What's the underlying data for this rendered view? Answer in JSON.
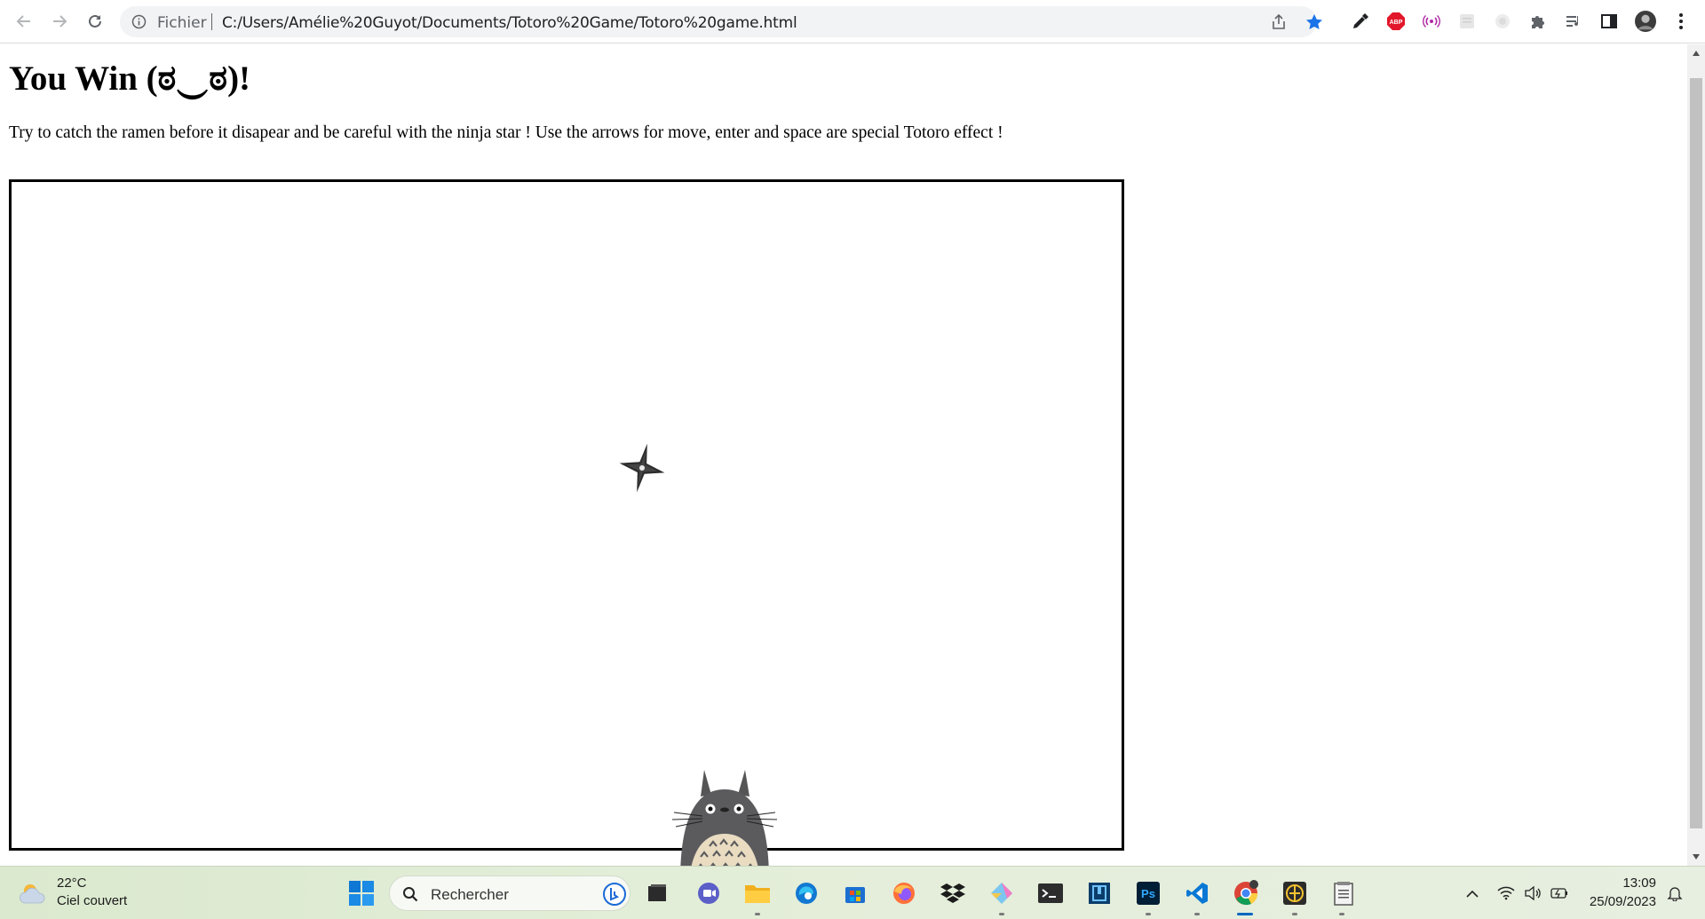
{
  "browser": {
    "scheme_label": "Fichier",
    "url": "C:/Users/Amélie%20Guyot/Documents/Totoro%20Game/Totoro%20game.html",
    "icons": [
      "back-icon",
      "forward-icon",
      "reload-icon",
      "info-icon",
      "share-icon",
      "bookmark-star-icon",
      "eyedropper-icon",
      "adblock-icon",
      "broadcast-icon",
      "extension-blank-icon",
      "extension-circle-icon",
      "puzzle-icon",
      "reading-list-icon",
      "side-panel-icon",
      "profile-avatar",
      "menu-dots-icon"
    ],
    "adblock_label": "ABP",
    "accent_color": "#1a73e8"
  },
  "page": {
    "title": "You Win (ಠ‿ಠ)!",
    "instructions": "Try to catch the ramen before it disapear and be careful with the ninja star ! Use the arrows for move, enter and space are special Totoro effect !",
    "game": {
      "sprites": [
        "ninja-star",
        "totoro"
      ]
    }
  },
  "taskbar": {
    "weather": {
      "temperature": "22°C",
      "condition": "Ciel couvert"
    },
    "search_placeholder": "Rechercher",
    "apps": [
      "file-explorer-app",
      "teams-chat-app",
      "folder-app",
      "edge-app",
      "store-app",
      "firefox-app",
      "dropbox-app",
      "git-app",
      "terminal-app",
      "dev-app",
      "photoshop-app",
      "vscode-app",
      "chrome-app",
      "eclipse-app",
      "notepad-app"
    ],
    "photoshop_label": "Ps",
    "clock": {
      "time": "13:09",
      "date": "25/09/2023"
    }
  }
}
